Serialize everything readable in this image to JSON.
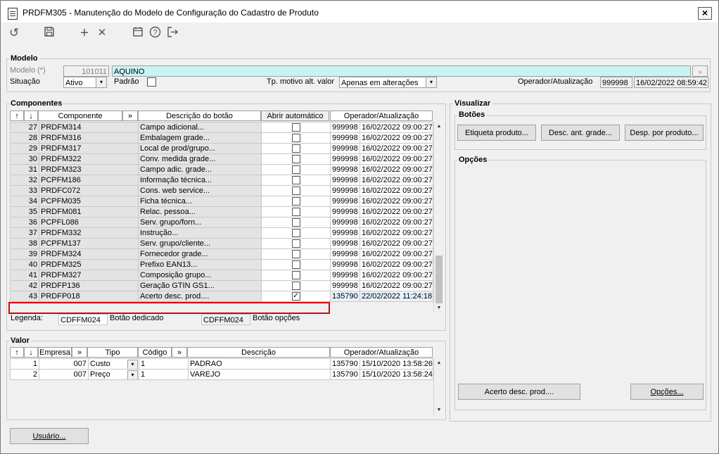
{
  "window": {
    "title": "PRDFM305 - Manutenção do Modelo de Configuração do Cadastro de Produto",
    "close_symbol": "×"
  },
  "toolbar": {
    "icons": [
      "undo-icon",
      "save-icon",
      "add-icon",
      "delete-icon",
      "calendar-icon",
      "help-icon",
      "exit-icon"
    ],
    "glyphs": [
      "↺",
      "🖫",
      "+",
      "✕",
      "🗓",
      "?",
      "⇥"
    ]
  },
  "modelo": {
    "title": "Modelo",
    "modelo_label": "Modelo (*)",
    "modelo_code": "101011",
    "modelo_name": "AQUINO",
    "situacao_label": "Situação",
    "situacao_value": "Ativo",
    "padrao_label": "Padrão",
    "tp_motivo_label": "Tp. motivo alt. valor",
    "tp_motivo_value": "Apenas em alterações",
    "operador_label": "Operador/Atualização",
    "operador_value": "999998",
    "data_value": "16/02/2022 08:59:42",
    "lookup_symbol": "»"
  },
  "componentes": {
    "title": "Componentes",
    "headers": {
      "up": "↑",
      "down": "↓",
      "componente": "Componente",
      "more": "»",
      "descricao": "Descrição do botão",
      "abrir": "Abrir automático",
      "operador": "Operador/Atualização"
    },
    "rows": [
      {
        "n": "27",
        "code": "PRDFM314",
        "desc": "Campo adicional...",
        "checked": "",
        "op": "999998",
        "date": "16/02/2022 09:00:27"
      },
      {
        "n": "28",
        "code": "PRDFM316",
        "desc": "Embalagem grade...",
        "checked": "",
        "op": "999998",
        "date": "16/02/2022 09:00:27"
      },
      {
        "n": "29",
        "code": "PRDFM317",
        "desc": "Local de prod/grupo...",
        "checked": "",
        "op": "999998",
        "date": "16/02/2022 09:00:27"
      },
      {
        "n": "30",
        "code": "PRDFM322",
        "desc": "Conv. medida grade...",
        "checked": "",
        "op": "999998",
        "date": "16/02/2022 09:00:27"
      },
      {
        "n": "31",
        "code": "PRDFM323",
        "desc": "Campo adic. grade...",
        "checked": "",
        "op": "999998",
        "date": "16/02/2022 09:00:27"
      },
      {
        "n": "32",
        "code": "PCPFM186",
        "desc": "Informação técnica...",
        "checked": "",
        "op": "999998",
        "date": "16/02/2022 09:00:27"
      },
      {
        "n": "33",
        "code": "PRDFC072",
        "desc": "Cons. web service...",
        "checked": "",
        "op": "999998",
        "date": "16/02/2022 09:00:27"
      },
      {
        "n": "34",
        "code": "PCPFM035",
        "desc": "Ficha técnica...",
        "checked": "",
        "op": "999998",
        "date": "16/02/2022 09:00:27"
      },
      {
        "n": "35",
        "code": "PRDFM081",
        "desc": "Relac. pessoa...",
        "checked": "",
        "op": "999998",
        "date": "16/02/2022 09:00:27"
      },
      {
        "n": "36",
        "code": "PCPFL086",
        "desc": "Serv. grupo/forn...",
        "checked": "",
        "op": "999998",
        "date": "16/02/2022 09:00:27"
      },
      {
        "n": "37",
        "code": "PRDFM332",
        "desc": "Instrução...",
        "checked": "",
        "op": "999998",
        "date": "16/02/2022 09:00:27"
      },
      {
        "n": "38",
        "code": "PCPFM137",
        "desc": "Serv. grupo/cliente...",
        "checked": "",
        "op": "999998",
        "date": "16/02/2022 09:00:27"
      },
      {
        "n": "39",
        "code": "PRDFM324",
        "desc": "Fornecedor grade...",
        "checked": "",
        "op": "999998",
        "date": "16/02/2022 09:00:27"
      },
      {
        "n": "40",
        "code": "PRDFM325",
        "desc": "Prefixo EAN13...",
        "checked": "",
        "op": "999998",
        "date": "16/02/2022 09:00:27"
      },
      {
        "n": "41",
        "code": "PRDFM327",
        "desc": "Composição grupo...",
        "checked": "",
        "op": "999998",
        "date": "16/02/2022 09:00:27"
      },
      {
        "n": "42",
        "code": "PRDFP136",
        "desc": "Geração GTIN GS1...",
        "checked": "",
        "op": "999998",
        "date": "16/02/2022 09:00:27"
      },
      {
        "n": "43",
        "code": "PRDFP018",
        "desc": "Acerto desc. prod....",
        "checked": "✓",
        "op": "135790",
        "date": "22/02/2022 11:24:18"
      }
    ],
    "legenda_label": "Legenda:",
    "legenda_code1": "CDFFM024",
    "legenda_text1": "Botão dedicado",
    "legenda_code2": "CDFFM024",
    "legenda_text2": "Botão opções"
  },
  "valor": {
    "title": "Valor",
    "headers": {
      "up": "↑",
      "down": "↓",
      "empresa": "Empresa",
      "more1": "»",
      "tipo": "Tipo",
      "codigo": "Código",
      "more2": "»",
      "descricao": "Descrição",
      "operador": "Operador/Atualização"
    },
    "rows": [
      {
        "n": "1",
        "empresa": "007",
        "tipo": "Custo",
        "codigo": "1",
        "desc": "PADRAO",
        "op": "135790",
        "date": "15/10/2020 13:58:26"
      },
      {
        "n": "2",
        "empresa": "007",
        "tipo": "Preço",
        "codigo": "1",
        "desc": "VAREJO",
        "op": "135790",
        "date": "15/10/2020 13:58:24"
      }
    ]
  },
  "visualizar": {
    "title": "Visualizar",
    "botoes_title": "Botões",
    "botoes": [
      "Etiqueta produto...",
      "Desc. ant. grade...",
      "Desp. por produto..."
    ],
    "opcoes_title": "Opções",
    "acerto_button": "Acerto desc. prod....",
    "opcoes_button": "Opções..."
  },
  "footer": {
    "usuario_button": "Usuário..."
  },
  "combo_arrow": "▾",
  "scroll_up": "▲",
  "scroll_down": "▼"
}
